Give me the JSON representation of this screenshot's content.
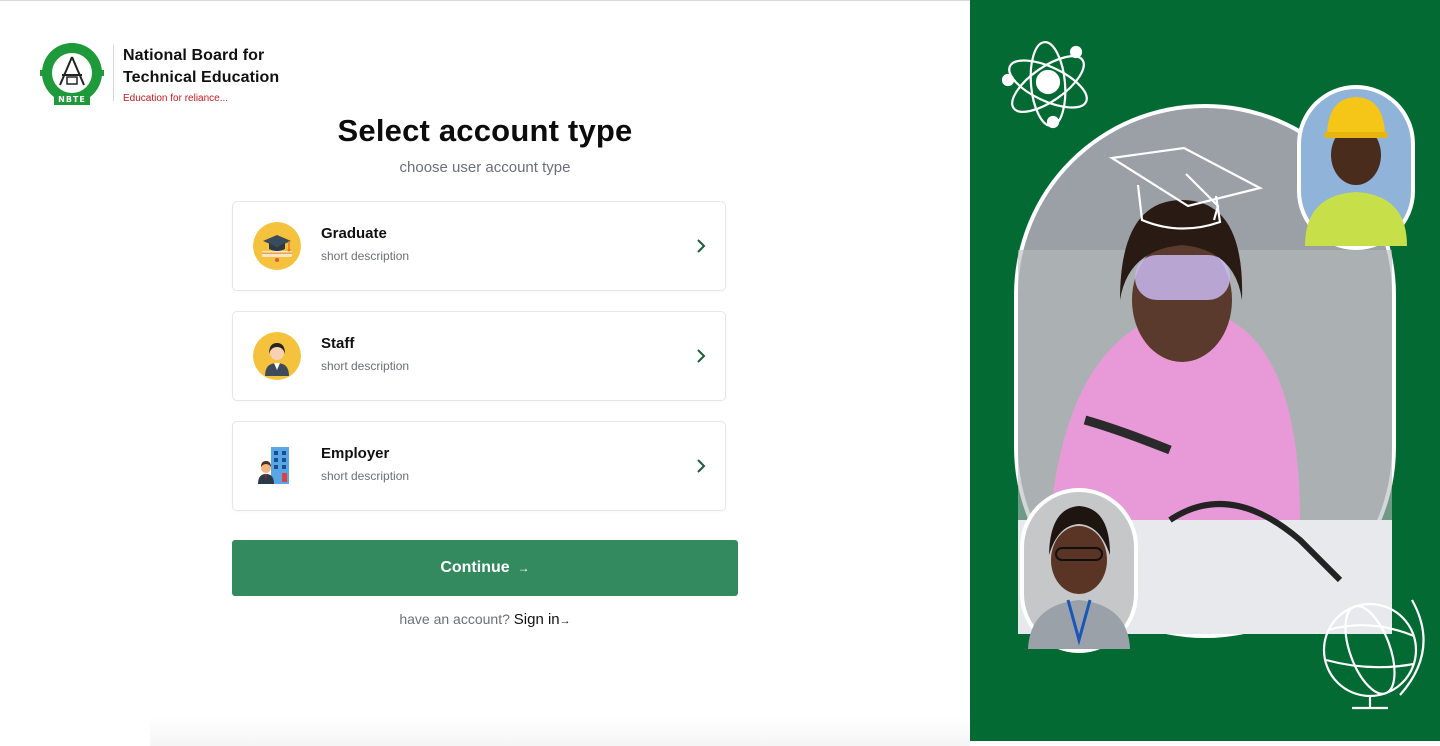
{
  "brand": {
    "org_line1": "National Board for",
    "org_line2": "Technical Education",
    "tagline": "Education for reliance...",
    "logo_text": "NBTE",
    "logo_color": "#1e9a3a",
    "tagline_color": "#c8171e"
  },
  "page": {
    "title": "Select account type",
    "subtitle": "choose user account type"
  },
  "account_types": [
    {
      "label": "Graduate",
      "description": "short description",
      "icon": "graduate-cap-icon"
    },
    {
      "label": "Staff",
      "description": "short description",
      "icon": "staff-person-icon"
    },
    {
      "label": "Employer",
      "description": "short description",
      "icon": "employer-building-icon"
    }
  ],
  "actions": {
    "continue_label": "Continue",
    "continue_arrow": "→",
    "signin_prompt": "have an account?",
    "signin_label": "Sign in",
    "signin_arrow": "→"
  },
  "colors": {
    "panel_green": "#046a34",
    "button_green": "#338a5e"
  }
}
